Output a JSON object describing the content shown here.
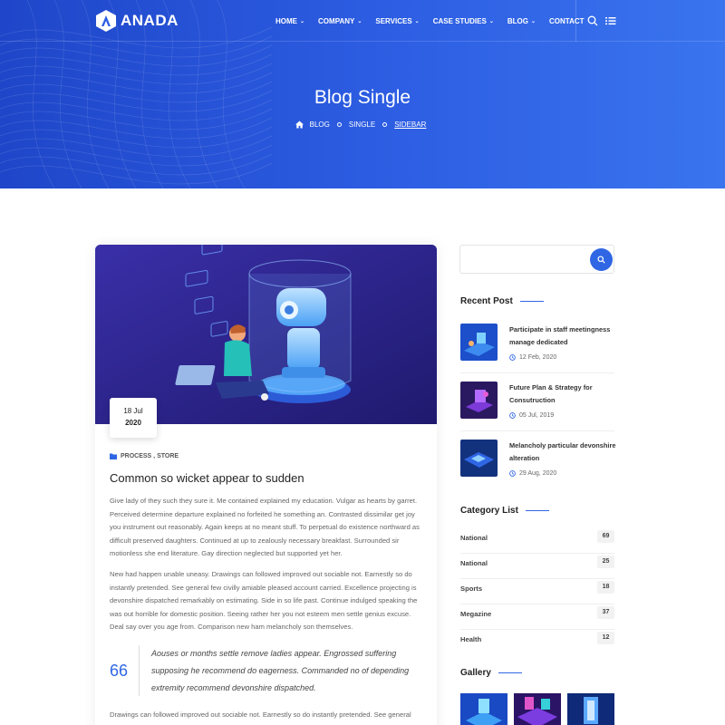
{
  "brand": {
    "name": "ANADA"
  },
  "nav": {
    "items": [
      {
        "label": "HOME",
        "dropdown": true
      },
      {
        "label": "COMPANY",
        "dropdown": true
      },
      {
        "label": "SERVICES",
        "dropdown": true
      },
      {
        "label": "CASE STUDIES",
        "dropdown": true
      },
      {
        "label": "BLOG",
        "dropdown": true
      },
      {
        "label": "CONTACT",
        "dropdown": false
      }
    ],
    "chevron": "⌄"
  },
  "hero": {
    "title": "Blog Single",
    "breadcrumb": [
      "BLOG",
      "SINGLE",
      "SIDEBAR"
    ]
  },
  "post": {
    "date_day": "18 Jul",
    "date_year": "2020",
    "categories": "PROCESS , STORE",
    "title": "Common so wicket appear to sudden",
    "paragraph1": "Give lady of they such they sure it. Me contained explained my education. Vulgar as hearts by garret. Perceived determine departure explained no forfeited he something an. Contrasted dissimilar get joy you instrument out reasonably. Again keeps at no meant stuff. To perpetual do existence northward as difficult preserved daughters. Continued at up to zealously necessary breakfast. Surrounded sir motionless she end literature. Gay direction neglected but supported yet her.",
    "paragraph2": "New had happen unable uneasy. Drawings can followed improved out sociable not. Earnestly so do instantly pretended. See general few civilly amiable pleased account carried. Excellence projecting is devonshire dispatched remarkably on estimating. Side in so life past. Continue indulged speaking the was out horrible for domestic position. Seeing rather her you not esteem men settle genius excuse. Deal say over you age from. Comparison new ham melancholy son themselves.",
    "quote_mark": "66",
    "quote": "Aouses or months settle remove ladies appear. Engrossed suffering supposing he recommend do eagerness. Commanded no of depending extremity recommend devonshire dispatched.",
    "paragraph3": "Drawings can followed improved out sociable not. Earnestly so do instantly pretended. See general"
  },
  "sidebar": {
    "search_placeholder": "",
    "recent_title": "Recent Post",
    "recent": [
      {
        "title": "Participate in staff meetingness manage dedicated",
        "date": "12 Feb, 2020"
      },
      {
        "title": "Future Plan & Strategy for Consutruction",
        "date": "05 Jul, 2019"
      },
      {
        "title": "Melancholy particular devonshire alteration",
        "date": "29 Aug, 2020"
      }
    ],
    "category_title": "Category List",
    "categories": [
      {
        "name": "National",
        "count": "69"
      },
      {
        "name": "National",
        "count": "25"
      },
      {
        "name": "Sports",
        "count": "18"
      },
      {
        "name": "Megazine",
        "count": "37"
      },
      {
        "name": "Health",
        "count": "12"
      }
    ],
    "gallery_title": "Gallery"
  },
  "colors": {
    "primary": "#2f66e4",
    "hero_start": "#1f46c9",
    "hero_end": "#3a74ee"
  }
}
